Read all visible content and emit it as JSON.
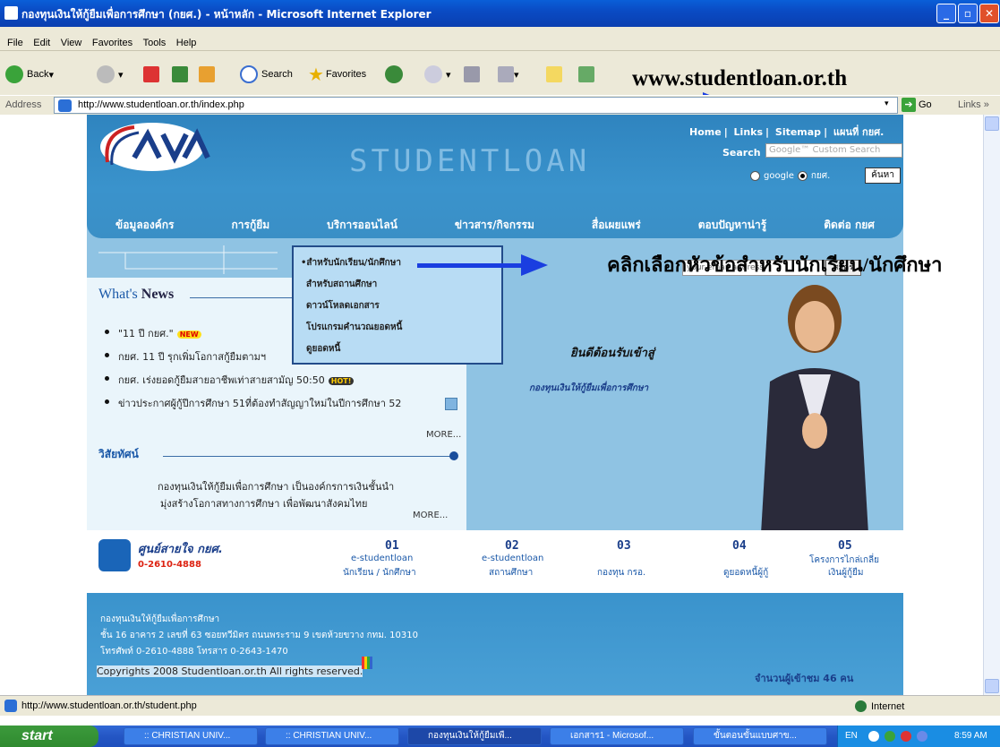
{
  "window": {
    "title": "กองทุนเงินให้กู้ยืมเพื่อการศึกษา (กยศ.) - หน้าหลัก - Microsoft Internet Explorer"
  },
  "menu": [
    "File",
    "Edit",
    "View",
    "Favorites",
    "Tools",
    "Help"
  ],
  "toolbar": {
    "back": "Back",
    "search": "Search",
    "favorites": "Favorites"
  },
  "annotation": {
    "url": "www.studentloan.or.th",
    "callout": "คลิกเลือกหัวข้อสำหรับนักเรียน/นักศึกษา"
  },
  "address": {
    "label": "Address",
    "url": "http://www.studentloan.or.th/index.php",
    "go": "Go",
    "links": "Links"
  },
  "site": {
    "toplinks": [
      "Home",
      "Links",
      "Sitemap",
      "แผนที่ กยศ."
    ],
    "watermark": "STUDENTLOAN",
    "search_label": "Search",
    "search_placeholder": "Google™ Custom Search",
    "radio_google": "google",
    "radio_kysh": "กยศ.",
    "search_button": "ค้นหา",
    "nav": [
      "ข้อมูลองค์กร",
      "การกู้ยืม",
      "บริการออนไลน์",
      "ข่าวสาร/กิจกรรม",
      "สื่อเผยแพร่",
      "ตอบปัญหาน่ารู้",
      "ติดต่อ กยศ"
    ],
    "dropdown": [
      "•สำหรับนักเรียน/นักศึกษา",
      "สำหรับสถานศึกษา",
      "ดาวน์โหลดเอกสาร",
      "โปรแกรมคำนวณยอดหนี้",
      "ดูยอดหนี้"
    ],
    "email_placeholder": "your-email address",
    "email_button": "สมัคร",
    "news_title_a": "What's",
    "news_title_b": "News",
    "news": [
      "\"11 ปี กยศ.\"",
      "กยศ. 11 ปี รุกเพิ่มโอกาสกู้ยืมตามฯ",
      "กยศ. เร่งยอดกู้ยืมสายอาชีพเท่าสายสามัญ 50:50",
      "ข่าวประกาศผู้กู้ปีการศึกษา 51ที่ต้องทำสัญญาใหม่ในปีการศึกษา 52"
    ],
    "badge_new": "NEW",
    "badge_hot": "HOT!",
    "more": "MORE...",
    "vision_title": "วิสัยทัศน์",
    "vision_text_1": "กองทุนเงินให้กู้ยืมเพื่อการศึกษา เป็นองค์กรการเงินชั้นนำ",
    "vision_text_2": "มุ่งสร้างโอกาสทางการศึกษา เพื่อพัฒนาสังคมไทย",
    "welcome": "ยินดีต้อนรับเข้าสู่",
    "welcome_sub": "กองทุนเงินให้กู้ยืมเพื่อการศึกษา",
    "hotline_label": "ศูนย์สายใจ กยศ.",
    "hotline_num": "0-2610-4888",
    "strip": [
      {
        "num": "01",
        "l1": "e-studentloan",
        "l2": "นักเรียน / นักศึกษา"
      },
      {
        "num": "02",
        "l1": "e-studentloan",
        "l2": "สถานศึกษา"
      },
      {
        "num": "03",
        "l1": "",
        "l2": "กองทุน กรอ."
      },
      {
        "num": "04",
        "l1": "",
        "l2": "ดูยอดหนี้ผู้กู้"
      },
      {
        "num": "05",
        "l1": "โครงการไกล่เกลี่ย",
        "l2": "เงินผู้กู้ยืม"
      }
    ],
    "footer_lines": [
      "กองทุนเงินให้กู้ยืมเพื่อการศึกษา",
      "ชั้น 16 อาคาร 2 เลขที่ 63 ซอยทวีมิตร ถนนพระราม 9 เขตห้วยขวาง กทม. 10310",
      "โทรศัพท์ 0-2610-4888   โทรสาร 0-2643-1470"
    ],
    "copyright": "Copyrights 2008 Studentloan.or.th All rights reserved.",
    "visitors": "จำนวนผู้เข้าชม 46 คน"
  },
  "status": {
    "url": "http://www.studentloan.or.th/student.php",
    "zone": "Internet"
  },
  "taskbar": {
    "start": "start",
    "tasks": [
      ":: CHRISTIAN UNIV...",
      ":: CHRISTIAN UNIV...",
      "กองทุนเงินให้กู้ยืมเพื...",
      "เอกสาร1 - Microsof...",
      "ขั้นตอนขั้นแบบศาข..."
    ],
    "lang": "EN",
    "clock": "8:59 AM"
  },
  "colors": {
    "titlebar": "#0a4bc4",
    "header": "#3a93cc",
    "accent_arrow": "#1a3ee0"
  }
}
